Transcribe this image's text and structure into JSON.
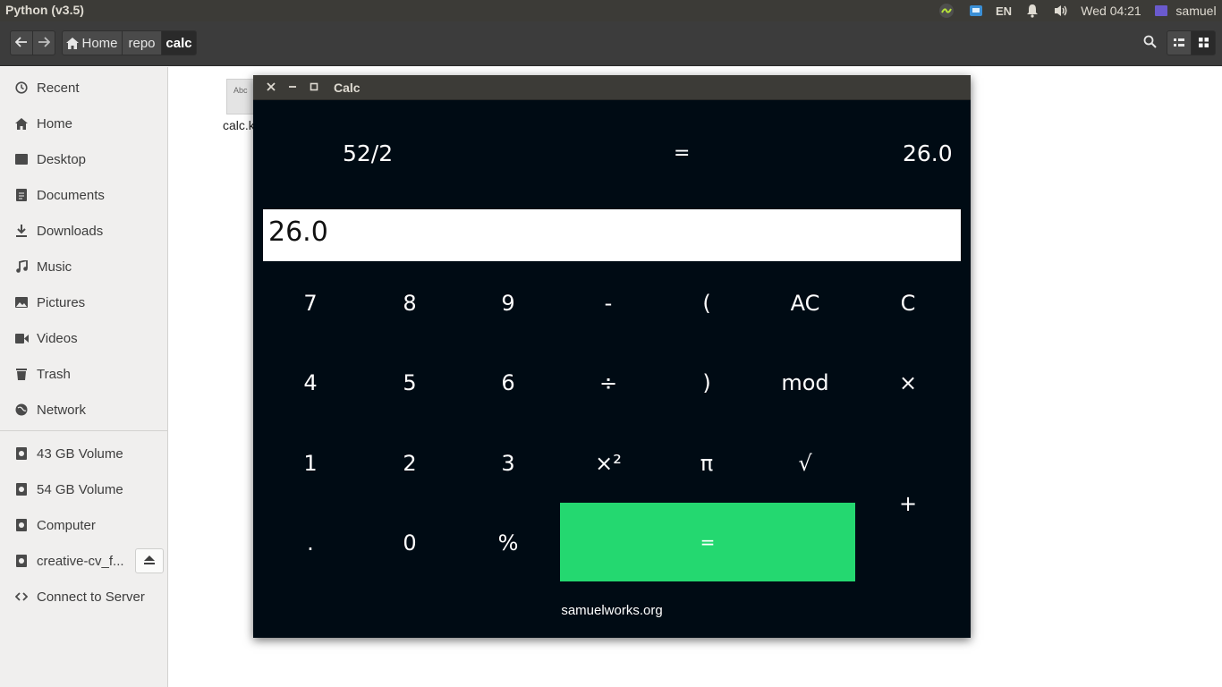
{
  "top_panel": {
    "app_title": "Python (v3.5)",
    "keyboard_layout": "EN",
    "clock": "Wed 04:21",
    "user": "samuel",
    "icons": [
      "app-indicator-icon",
      "window-indicator-icon",
      "bell-icon",
      "volume-icon",
      "user-icon"
    ]
  },
  "header_bar": {
    "back_icon": "arrow-left-icon",
    "forward_icon": "arrow-right-icon",
    "breadcrumbs": [
      "Home",
      "repo",
      "calc"
    ],
    "tools": [
      "search-icon",
      "list-view-icon",
      "grid-view-icon"
    ]
  },
  "sidebar": {
    "items": [
      {
        "label": "Recent",
        "icon": "clock-icon"
      },
      {
        "label": "Home",
        "icon": "home-icon"
      },
      {
        "label": "Desktop",
        "icon": "desktop-icon"
      },
      {
        "label": "Documents",
        "icon": "document-icon"
      },
      {
        "label": "Downloads",
        "icon": "download-icon"
      },
      {
        "label": "Music",
        "icon": "music-icon"
      },
      {
        "label": "Pictures",
        "icon": "picture-icon"
      },
      {
        "label": "Videos",
        "icon": "video-icon"
      },
      {
        "label": "Trash",
        "icon": "trash-icon"
      },
      {
        "label": "Network",
        "icon": "network-icon"
      }
    ],
    "devices": [
      {
        "label": "43 GB Volume",
        "icon": "drive-icon"
      },
      {
        "label": "54 GB Volume",
        "icon": "drive-icon"
      },
      {
        "label": "Computer",
        "icon": "drive-icon"
      },
      {
        "label": "creative-cv_f...",
        "icon": "drive-icon"
      },
      {
        "label": "Connect to Server",
        "icon": "server-icon"
      }
    ]
  },
  "content": {
    "file_name": "calc.k",
    "file_thumb_text": "Abc"
  },
  "calc": {
    "title": "Calc",
    "expression": "52/2",
    "equals_sign": "=",
    "result": "26.0",
    "entry_value": "26.0",
    "keys": {
      "k7": "7",
      "k8": "8",
      "k9": "9",
      "minus": "-",
      "lparen": "(",
      "ac": "AC",
      "c": "C",
      "k4": "4",
      "k5": "5",
      "k6": "6",
      "divide": "÷",
      "rparen": ")",
      "mod": "mod",
      "times": "×",
      "k1": "1",
      "k2": "2",
      "k3": "3",
      "square": "×²",
      "pi": "π",
      "sqrt": "√",
      "plus": "+",
      "dot": ".",
      "k0": "0",
      "percent": "%",
      "equals": "="
    },
    "footer": "samuelworks.org",
    "colors": {
      "background": "#000b14",
      "equals_button": "#24d870"
    }
  }
}
